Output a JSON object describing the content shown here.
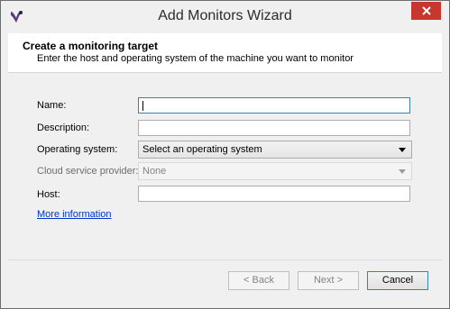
{
  "window": {
    "title": "Add Monitors Wizard",
    "app_icon": "wizard-app-icon",
    "close_icon": "close-icon",
    "close_color": "#c7362f"
  },
  "header": {
    "title": "Create a monitoring target",
    "subtitle": "Enter the host and operating system of the machine you want to monitor"
  },
  "form": {
    "name": {
      "label": "Name:",
      "value": ""
    },
    "description": {
      "label": "Description:",
      "value": ""
    },
    "operating_system": {
      "label": "Operating system:",
      "value": "Select an operating system"
    },
    "cloud_provider": {
      "label": "Cloud service provider:",
      "value": "None",
      "disabled": true
    },
    "host": {
      "label": "Host:",
      "value": ""
    },
    "more_info_link": "More information"
  },
  "buttons": {
    "back": "< Back",
    "next": "Next >",
    "cancel": "Cancel"
  },
  "colors": {
    "link": "#0033cc",
    "focus_border": "#3c7fb1"
  }
}
